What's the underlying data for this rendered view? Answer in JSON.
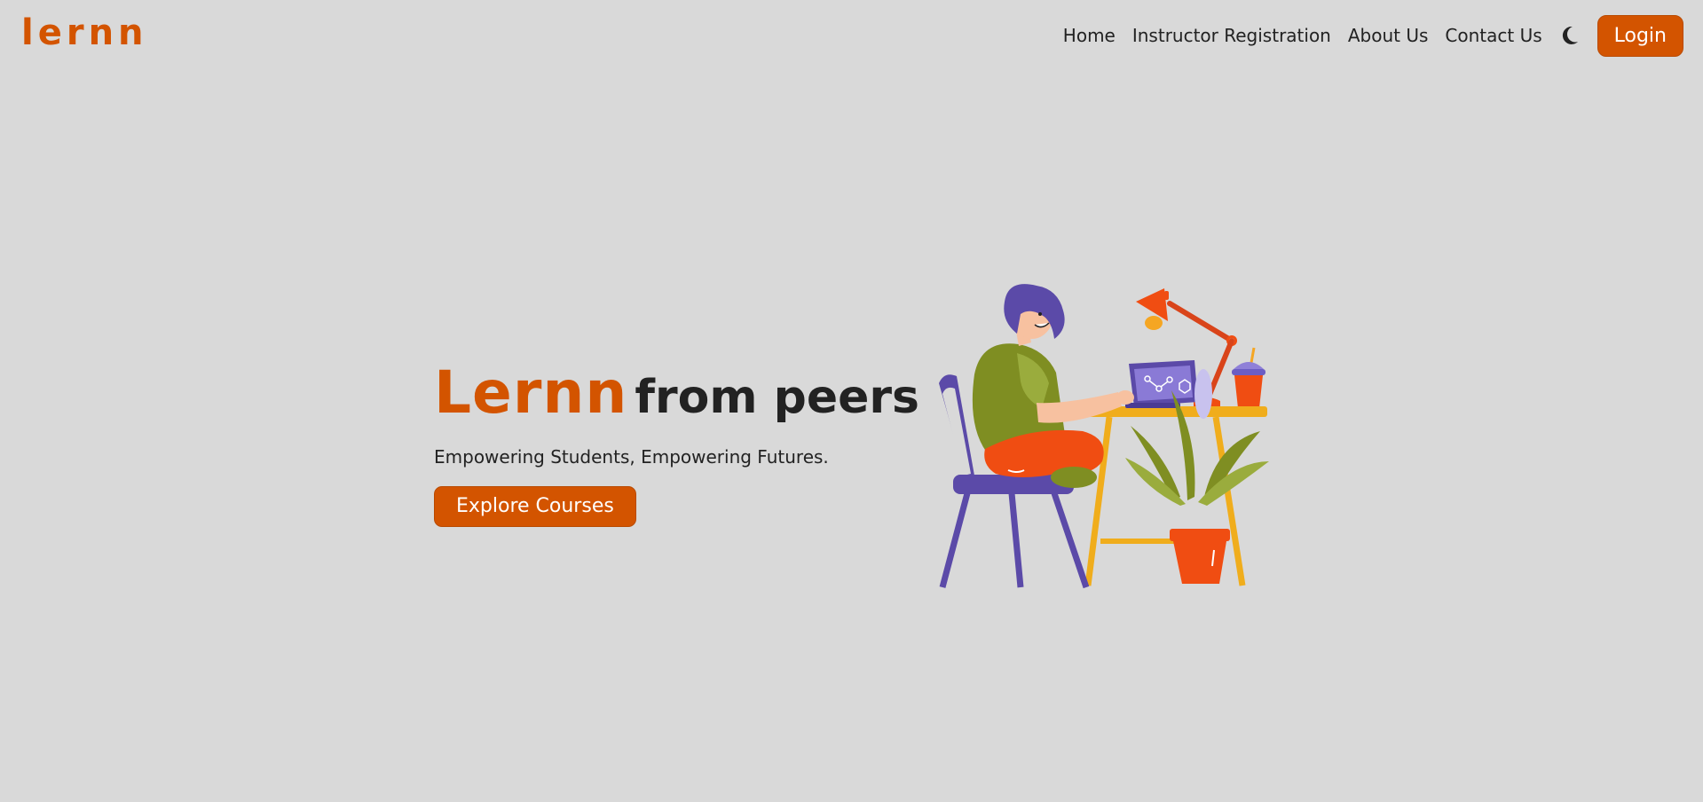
{
  "navbar": {
    "brand": "lernn",
    "links": [
      "Home",
      "Instructor Registration",
      "About Us",
      "Contact Us"
    ],
    "theme_icon": "moon-icon",
    "login_label": "Login"
  },
  "hero": {
    "title_brand": "Lernn",
    "title_rest": "from peers",
    "subtitle": "Empowering Students, Empowering Futures.",
    "cta_label": "Explore Courses",
    "illustration": "student-at-desk-illustration"
  },
  "colors": {
    "background": "#d9d9d9",
    "accent": "#d35400",
    "text": "#222222"
  }
}
